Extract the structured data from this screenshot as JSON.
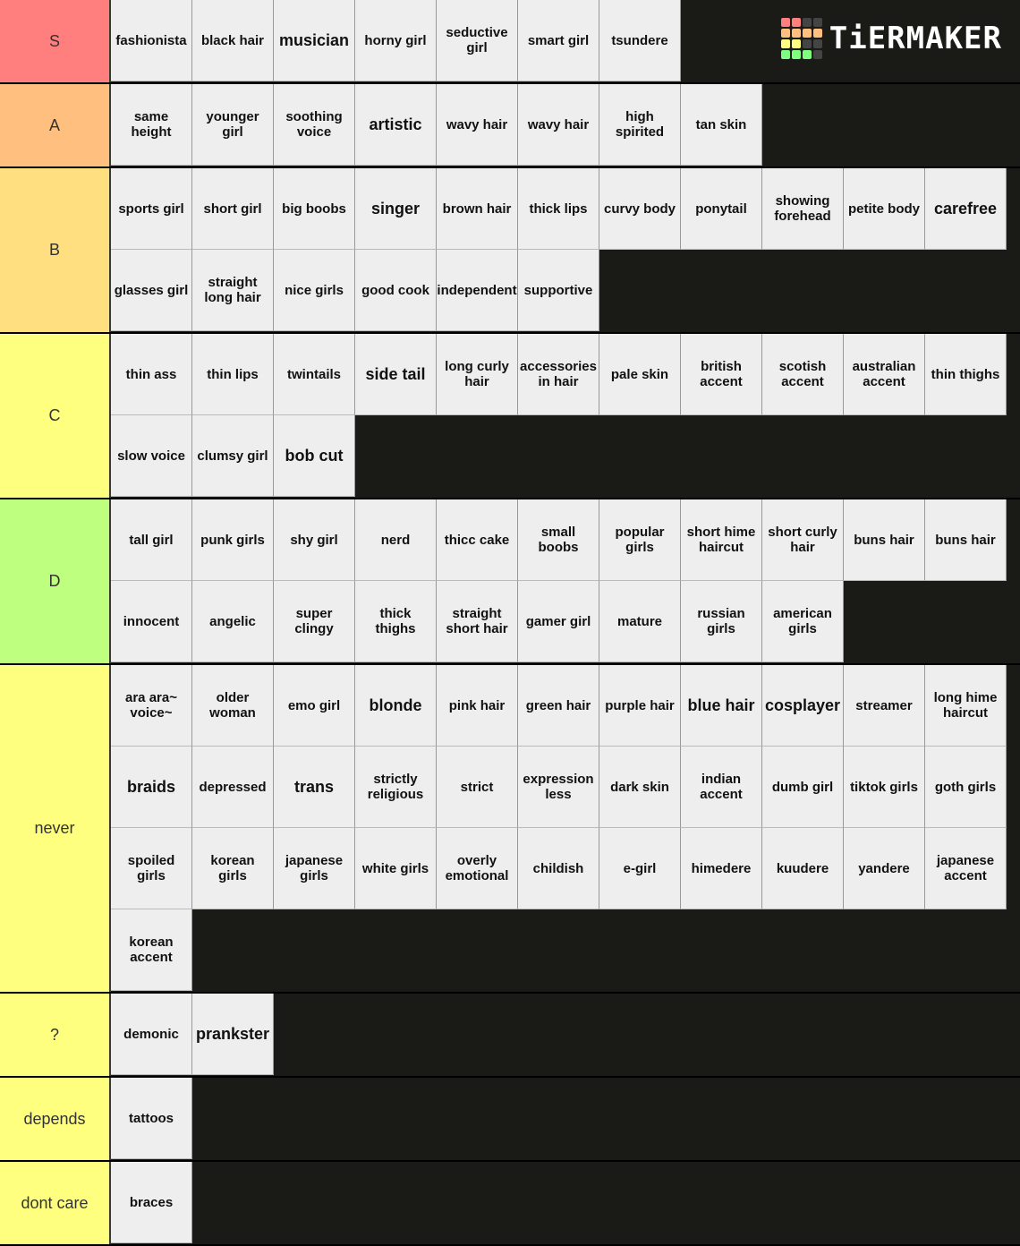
{
  "brand": {
    "name": "TiERMAKER",
    "grid_colors": [
      "#ff7f7f",
      "#ff7f7f",
      "#444444",
      "#444444",
      "#ffbf7f",
      "#ffbf7f",
      "#ffbf7f",
      "#ffbf7f",
      "#ffff7f",
      "#ffff7f",
      "#444444",
      "#444444",
      "#7fff7f",
      "#7fff7f",
      "#7fff7f",
      "#444444"
    ]
  },
  "tiers": [
    {
      "label": "S",
      "color": "#ff7f7f",
      "rows": 1,
      "items": [
        "fashionista",
        "black hair",
        "musician",
        "horny girl",
        "seductive\ngirl",
        "smart girl",
        "tsundere"
      ]
    },
    {
      "label": "A",
      "color": "#ffbf7f",
      "rows": 1,
      "items": [
        "same\nheight",
        "younger\ngirl",
        "soothing\nvoice",
        "artistic",
        "wavy hair",
        "wavy hair",
        "high\nspirited",
        "tan skin"
      ]
    },
    {
      "label": "B",
      "color": "#ffdf7f",
      "rows": 2,
      "items": [
        "sports girl",
        "short girl",
        "big boobs",
        "singer",
        "brown hair",
        "thick lips",
        "curvy body",
        "ponytail",
        "showing\nforehead",
        "petite body",
        "carefree",
        "glasses girl",
        "straight\nlong hair",
        "nice girls",
        "good cook",
        "independent",
        "supportive"
      ]
    },
    {
      "label": "C",
      "color": "#ffff7f",
      "rows": 2,
      "items": [
        "thin ass",
        "thin lips",
        "twintails",
        "side tail",
        "long curly\nhair",
        "accessories\nin hair",
        "pale skin",
        "british\naccent",
        "scotish\naccent",
        "australian\naccent",
        "thin thighs",
        "slow voice",
        "clumsy girl",
        "bob cut"
      ]
    },
    {
      "label": "D",
      "color": "#bfff7f",
      "rows": 2,
      "items": [
        "tall girl",
        "punk girls",
        "shy girl",
        "nerd",
        "thicc cake",
        "small\nboobs",
        "popular\ngirls",
        "short hime\nhaircut",
        "short curly\nhair",
        "buns hair",
        "buns hair",
        "innocent",
        "angelic",
        "super\nclingy",
        "thick\nthighs",
        "straight\nshort hair",
        "gamer girl",
        "mature",
        "russian\ngirls",
        "american\ngirls"
      ]
    },
    {
      "label": "never",
      "color": "#ffff7f",
      "rows": 4,
      "items": [
        "ara ara~\nvoice~",
        "older\nwoman",
        "emo girl",
        "blonde",
        "pink hair",
        "green hair",
        "purple hair",
        "blue hair",
        "cosplayer",
        "streamer",
        "long hime\nhaircut",
        "braids",
        "depressed",
        "trans",
        "strictly\nreligious",
        "strict",
        "expression\nless",
        "dark skin",
        "indian\naccent",
        "dumb girl",
        "tiktok girls",
        "goth girls",
        "spoiled\ngirls",
        "korean\ngirls",
        "japanese\ngirls",
        "white girls",
        "overly\nemotional",
        "childish",
        "e-girl",
        "himedere",
        "kuudere",
        "yandere",
        "japanese\naccent",
        "korean\naccent"
      ]
    },
    {
      "label": "?",
      "color": "#ffff7f",
      "rows": 1,
      "items": [
        "demonic",
        "prankster"
      ]
    },
    {
      "label": "depends",
      "color": "#ffff7f",
      "rows": 1,
      "items": [
        "tattoos"
      ]
    },
    {
      "label": "dont care",
      "color": "#ffff7f",
      "rows": 1,
      "items": [
        "braces"
      ]
    }
  ]
}
